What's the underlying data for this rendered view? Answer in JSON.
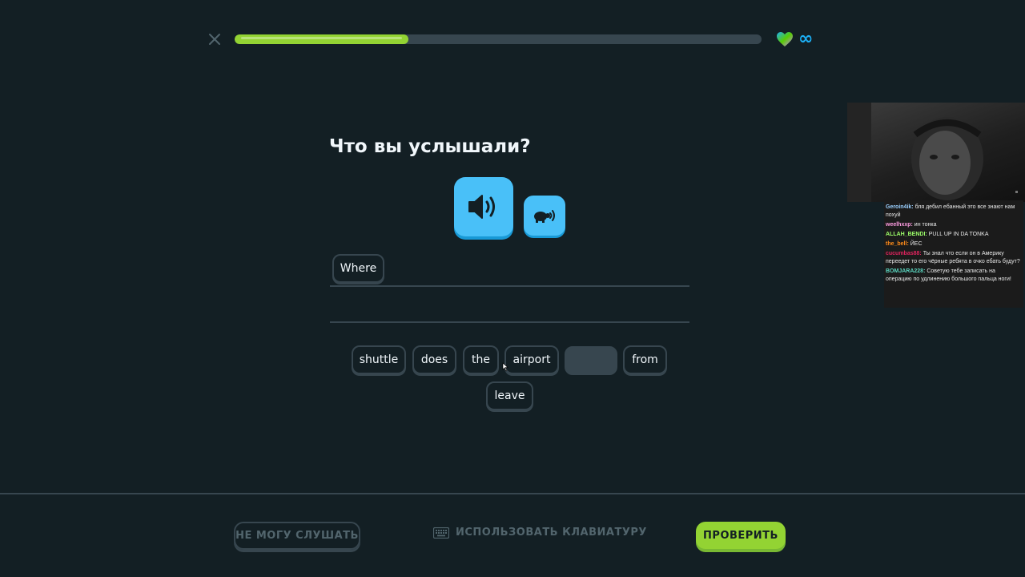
{
  "lesson": {
    "progress_fraction": 0.33,
    "hearts": "∞",
    "prompt": "Что вы услышали?"
  },
  "answer_chips": [
    {
      "label": "Where"
    }
  ],
  "word_bank": [
    {
      "label": "shuttle"
    },
    {
      "label": "does"
    },
    {
      "label": "the"
    },
    {
      "label": "airport"
    },
    {
      "label": ""
    },
    {
      "label": "from"
    },
    {
      "label": "leave"
    }
  ],
  "footer": {
    "cant_listen_label": "НЕ МОГУ СЛУШАТЬ",
    "keyboard_label": "ИСПОЛЬЗОВАТЬ КЛАВИАТУРУ",
    "check_label": "ПРОВЕРИТЬ"
  },
  "stream_chat": [
    {
      "user": "Geroin4ik:",
      "color": "#9ad0ff",
      "text": "бля дебил ебанный это все знают нам похуй"
    },
    {
      "user": "weelhxxp:",
      "color": "#ff9de2",
      "text": "ин тонка"
    },
    {
      "user": "ALLAH_BENDI:",
      "color": "#9dff6a",
      "text": "PULL UP IN DA TONKA"
    },
    {
      "user": "the_bell:",
      "color": "#ff8c1a",
      "text": "ЙЕС"
    },
    {
      "user": "cucumbas88:",
      "color": "#e0245e",
      "text": "Ты знал что если он в Америку переедет то его чёрные ребята в очко ебать будут?"
    },
    {
      "user": "BOMJARA228:",
      "color": "#5bd6c0",
      "text": "Советую тебе записать на операцию по удлинению большого пальца ноги!"
    }
  ],
  "colors": {
    "background": "#131f24",
    "progress": "#93d333",
    "audio": "#49c0f8",
    "border": "#37464f"
  }
}
